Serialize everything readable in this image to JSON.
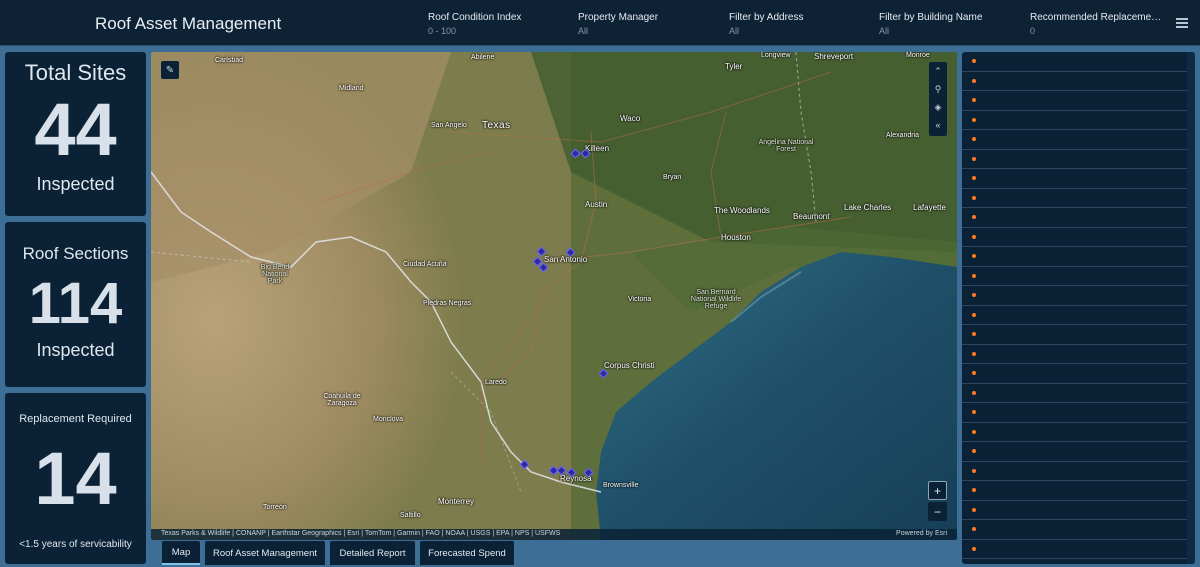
{
  "header": {
    "title": "Roof Asset Management",
    "filters": [
      {
        "label": "Roof Condition Index",
        "value": "0 - 100"
      },
      {
        "label": "Property Manager",
        "value": "All"
      },
      {
        "label": "Filter by Address",
        "value": "All"
      },
      {
        "label": "Filter by Building Name",
        "value": "All"
      },
      {
        "label": "Recommended Replacement ...",
        "value": "0"
      }
    ]
  },
  "stats": {
    "total_sites": {
      "title": "Total Sites",
      "value": "44",
      "sub": "Inspected"
    },
    "roof_sections": {
      "title": "Roof Sections",
      "value": "114",
      "sub": "Inspected"
    },
    "replacement": {
      "title": "Replacement Required",
      "value": "14",
      "sub": "<1.5 years of servicability"
    }
  },
  "map": {
    "places": {
      "carlsbad": "Carlsbad",
      "abilene": "Abilene",
      "longview": "Longview",
      "shreveport": "Shreveport",
      "monroe": "Monroe",
      "tyler": "Tyler",
      "midland": "Midland",
      "waco": "Waco",
      "san_angelo": "San Angelo",
      "texas": "Texas",
      "killeen": "Killeen",
      "angelina": "Angelina National Forest",
      "alexandria": "Alexandria",
      "bryan": "Bryan",
      "austin": "Austin",
      "the_woodlands": "The Woodlands",
      "beaumont": "Beaumont",
      "lake_charles": "Lake Charles",
      "lafayette": "Lafayette",
      "houston": "Houston",
      "big_bend": "Big Bend National Park",
      "ciudad_acuna": "Ciudad Acuña",
      "san_antonio": "San Antonio",
      "piedras_negras": "Piedras Negras",
      "victoria": "Victoria",
      "san_bernard": "San Bernard National Wildlife Refuge",
      "corpus_christi": "Corpus Christi",
      "laredo": "Laredo",
      "coahuila": "Coahuila de Zaragoza",
      "monclova": "Monclova",
      "reynosa": "Reynosa",
      "brownsville": "Brownsville",
      "monterrey": "Monterrey",
      "saltillo": "Saltillo",
      "torreon": "Torreón"
    },
    "attribution": "Texas Parks & Wildlife | CONANP | Earthstar Geographics | Esri | TomTom | Garmin | FAO | NOAA | USGS | EPA | NPS | USFWS",
    "powered_by": "Powered by Esri",
    "zoom_in": "+",
    "zoom_out": "−"
  },
  "tabs": [
    {
      "label": "Map"
    },
    {
      "label": "Roof Asset Management"
    },
    {
      "label": "Detailed Report"
    },
    {
      "label": "Forecasted Spend"
    }
  ],
  "list": {
    "row_count": 26,
    "bullet_color": "#ff7a1f"
  },
  "colors": {
    "header_bg": "#0e2236",
    "panel_bg": "#0b2236",
    "page_bg": "#3d6e96",
    "marker": "#2d2a9e"
  },
  "icons": [
    "menu-icon",
    "edit-icon",
    "collapse-up-icon",
    "search-icon",
    "layers-icon",
    "collapse-left-icon"
  ]
}
